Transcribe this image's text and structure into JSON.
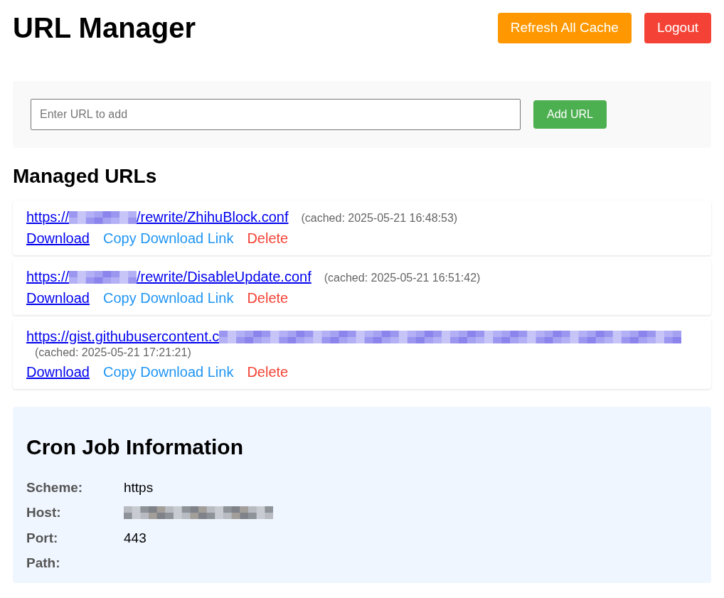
{
  "header": {
    "title": "URL Manager",
    "buttons": [
      {
        "label": "Refresh All Cache",
        "kind": "warning"
      },
      {
        "label": "Logout",
        "kind": "danger"
      }
    ]
  },
  "add_form": {
    "placeholder": "Enter URL to add",
    "button": "Add URL"
  },
  "managed_urls": {
    "heading": "Managed URLs",
    "items": [
      {
        "url_start": "https://",
        "url_end": "/rewrite/ZhihuBlock.conf",
        "redacted": true,
        "cached": "(cached: 2025-05-21 16:48:53)",
        "actions": [
          {
            "label": "Download",
            "kind": "download"
          },
          {
            "label": "Copy Download Link",
            "kind": "copy"
          },
          {
            "label": "Delete",
            "kind": "delete"
          }
        ]
      },
      {
        "url_start": "https://",
        "url_end": "/rewrite/DisableUpdate.conf",
        "redacted": true,
        "cached": "(cached: 2025-05-21 16:51:42)",
        "actions": [
          {
            "label": "Download",
            "kind": "download"
          },
          {
            "label": "Copy Download Link",
            "kind": "copy"
          },
          {
            "label": "Delete",
            "kind": "delete"
          }
        ]
      },
      {
        "url_start": "https://gist.githubusercontent.c",
        "redacted": true,
        "cached": "(cached: 2025-05-21 17:21:21)",
        "actions": [
          {
            "label": "Download",
            "kind": "download"
          },
          {
            "label": "Copy Download Link",
            "kind": "copy"
          },
          {
            "label": "Delete",
            "kind": "delete"
          }
        ]
      }
    ]
  },
  "cron_info": {
    "heading": "Cron Job Information",
    "rows": [
      {
        "label": "Scheme:",
        "value": "https",
        "redacted": false
      },
      {
        "label": "Host:",
        "redacted": true
      },
      {
        "label": "Port:",
        "value": "443",
        "redacted": false
      },
      {
        "label": "Path:",
        "redacted": false
      }
    ]
  }
}
